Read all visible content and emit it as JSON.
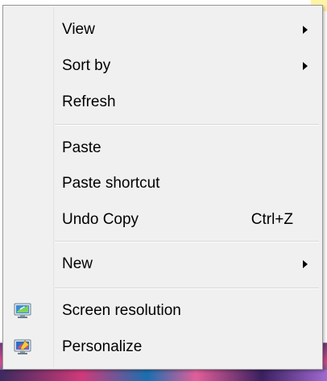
{
  "context_menu": {
    "items": [
      {
        "label": "View",
        "has_submenu": true
      },
      {
        "label": "Sort by",
        "has_submenu": true
      },
      {
        "label": "Refresh"
      },
      {
        "label": "Paste"
      },
      {
        "label": "Paste shortcut"
      },
      {
        "label": "Undo Copy",
        "shortcut": "Ctrl+Z"
      },
      {
        "label": "New",
        "has_submenu": true
      },
      {
        "label": "Screen resolution",
        "icon": "screen-resolution-icon"
      },
      {
        "label": "Personalize",
        "icon": "personalize-icon"
      }
    ]
  },
  "colors": {
    "menu_background": "#f0f0f0",
    "separator": "#d7d7d7",
    "text": "#000000"
  }
}
